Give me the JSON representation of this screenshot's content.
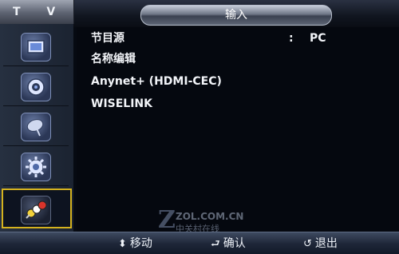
{
  "header": {
    "tv_label": "T V",
    "title": "输入"
  },
  "sidebar": {
    "items": [
      {
        "name": "picture",
        "icon": "picture-icon"
      },
      {
        "name": "sound",
        "icon": "speaker-icon"
      },
      {
        "name": "channel",
        "icon": "satellite-dish-icon"
      },
      {
        "name": "setup",
        "icon": "gear-icon"
      },
      {
        "name": "input",
        "icon": "av-cable-icon",
        "active": true
      }
    ]
  },
  "menu": {
    "items": [
      {
        "label": "节目源",
        "colon": ":",
        "value": "PC",
        "has_arrow": true
      },
      {
        "label": "名称编辑",
        "has_arrow": true
      },
      {
        "label": "Anynet+ (HDMI-CEC)"
      },
      {
        "label": "WISELINK"
      }
    ]
  },
  "footer": {
    "move": {
      "icon": "up-down-arrow-icon",
      "label": "移动"
    },
    "enter": {
      "icon": "enter-icon",
      "label": "确认"
    },
    "back": {
      "icon": "return-icon",
      "label": "退出"
    }
  },
  "watermark": {
    "letter": "Z",
    "site": "ZOL.COM.CN",
    "cn": "中关村在线"
  },
  "colors": {
    "accent_border": "#d4b21e",
    "text": "#f2f4f8",
    "background": "#05080f"
  }
}
